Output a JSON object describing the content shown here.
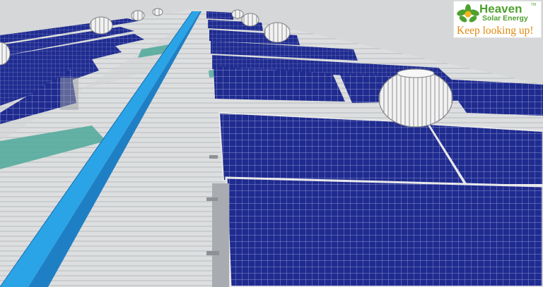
{
  "image": {
    "description_kind": "3D render of solar panel arrays on a corrugated metal roof with turbine ventilators and a blue ridge walkway"
  },
  "logo": {
    "brand": "Heaven",
    "sub": "Solar Energy",
    "tagline": "Keep looking up!",
    "tm": "TM",
    "colors": {
      "green": "#4ea12f",
      "orange": "#e08a10"
    }
  },
  "colors": {
    "panel": "#1e2a8c",
    "roof": "#d8dadc",
    "walkway": "#2aa4e6",
    "teal_patch": "#4ea89a"
  }
}
